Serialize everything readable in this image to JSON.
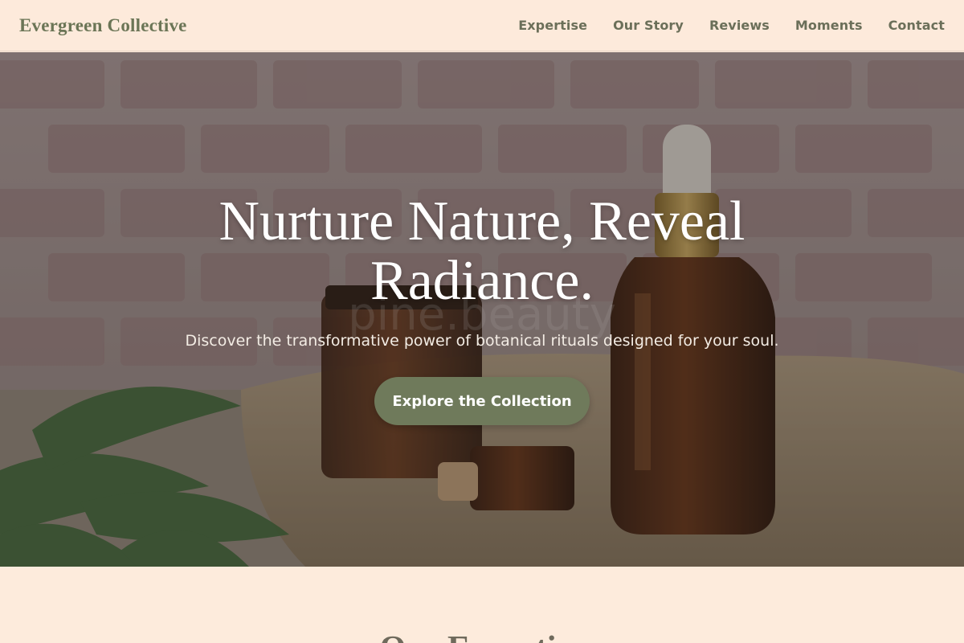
{
  "header": {
    "logo": "Evergreen Collective",
    "nav": [
      {
        "label": "Expertise"
      },
      {
        "label": "Our Story"
      },
      {
        "label": "Reviews"
      },
      {
        "label": "Moments"
      },
      {
        "label": "Contact"
      }
    ]
  },
  "hero": {
    "title": "Nurture Nature, Reveal Radiance.",
    "subtitle": "Discover the transformative power of botanical rituals designed for your soul.",
    "cta_label": "Explore the Collection",
    "watermark": "pine.beauty"
  },
  "expertise": {
    "title": "Our Expertise"
  },
  "colors": {
    "header_bg": "#fdeadb",
    "logo": "#6b7556",
    "nav_text": "#6b6f59",
    "cta_bg": "#6f7a5b",
    "page_bg": "#fdebdc"
  }
}
